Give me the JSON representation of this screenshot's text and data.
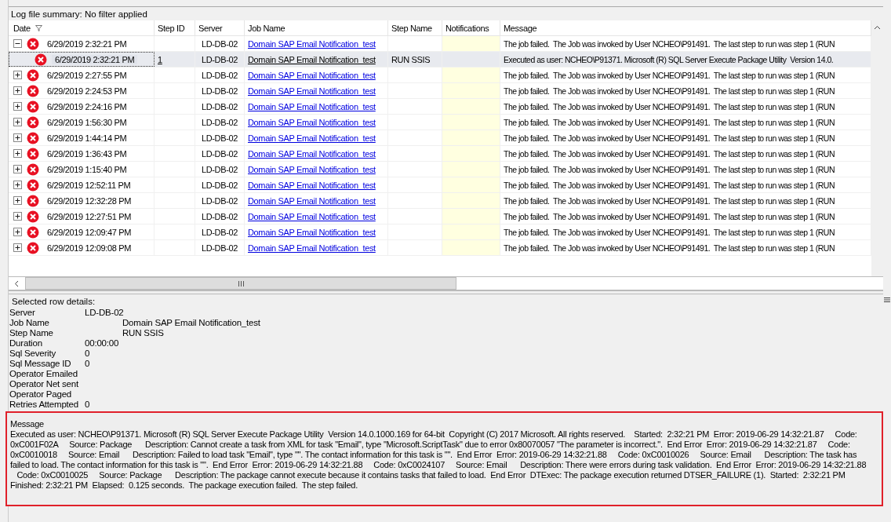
{
  "summary": "Log file summary: No filter applied",
  "columns": [
    {
      "label": "Date",
      "filter": true
    },
    {
      "label": "Step ID"
    },
    {
      "label": "Server"
    },
    {
      "label": "Job Name"
    },
    {
      "label": "Step Name"
    },
    {
      "label": "Notifications"
    },
    {
      "label": "Message"
    }
  ],
  "rows": [
    {
      "date": "6/29/2019 2:32:21 PM",
      "server": "LD-DB-02",
      "job": "Domain SAP Email Notification_test",
      "message": "The job failed.  The Job was invoked by User NCHEO\\P91491.  The last step to run was step 1 (RUN",
      "expanded": true,
      "selected": false,
      "children": [
        {
          "date": "6/29/2019 2:32:21 PM",
          "step_id": "1",
          "server": "LD-DB-02",
          "job": "Domain SAP Email Notification_test",
          "step_name": "RUN SSIS",
          "message": "Executed as user: NCHEO\\P91371. Microsoft (R) SQL Server Execute Package Utility  Version 14.0.",
          "selected": true
        }
      ]
    },
    {
      "date": "6/29/2019 2:27:55 PM",
      "server": "LD-DB-02",
      "job": "Domain SAP Email Notification_test",
      "message": "The job failed.  The Job was invoked by User NCHEO\\P91491.  The last step to run was step 1 (RUN",
      "expanded": false,
      "selected": false
    },
    {
      "date": "6/29/2019 2:24:53 PM",
      "server": "LD-DB-02",
      "job": "Domain SAP Email Notification_test",
      "message": "The job failed.  The Job was invoked by User NCHEO\\P91491.  The last step to run was step 1 (RUN",
      "expanded": false,
      "selected": false
    },
    {
      "date": "6/29/2019 2:24:16 PM",
      "server": "LD-DB-02",
      "job": "Domain SAP Email Notification_test",
      "message": "The job failed.  The Job was invoked by User NCHEO\\P91491.  The last step to run was step 1 (RUN",
      "expanded": false,
      "selected": false
    },
    {
      "date": "6/29/2019 1:56:30 PM",
      "server": "LD-DB-02",
      "job": "Domain SAP Email Notification_test",
      "message": "The job failed.  The Job was invoked by User NCHEO\\P91491.  The last step to run was step 1 (RUN",
      "expanded": false,
      "selected": false
    },
    {
      "date": "6/29/2019 1:44:14 PM",
      "server": "LD-DB-02",
      "job": "Domain SAP Email Notification_test",
      "message": "The job failed.  The Job was invoked by User NCHEO\\P91491.  The last step to run was step 1 (RUN",
      "expanded": false,
      "selected": false
    },
    {
      "date": "6/29/2019 1:36:43 PM",
      "server": "LD-DB-02",
      "job": "Domain SAP Email Notification_test",
      "message": "The job failed.  The Job was invoked by User NCHEO\\P91491.  The last step to run was step 1 (RUN",
      "expanded": false,
      "selected": false
    },
    {
      "date": "6/29/2019 1:15:40 PM",
      "server": "LD-DB-02",
      "job": "Domain SAP Email Notification_test",
      "message": "The job failed.  The Job was invoked by User NCHEO\\P91491.  The last step to run was step 1 (RUN",
      "expanded": false,
      "selected": false
    },
    {
      "date": "6/29/2019 12:52:11 PM",
      "server": "LD-DB-02",
      "job": "Domain SAP Email Notification_test",
      "message": "The job failed.  The Job was invoked by User NCHEO\\P91491.  The last step to run was step 1 (RUN",
      "expanded": false,
      "selected": false
    },
    {
      "date": "6/29/2019 12:32:28 PM",
      "server": "LD-DB-02",
      "job": "Domain SAP Email Notification_test",
      "message": "The job failed.  The Job was invoked by User NCHEO\\P91491.  The last step to run was step 1 (RUN",
      "expanded": false,
      "selected": false
    },
    {
      "date": "6/29/2019 12:27:51 PM",
      "server": "LD-DB-02",
      "job": "Domain SAP Email Notification_test",
      "message": "The job failed.  The Job was invoked by User NCHEO\\P91491.  The last step to run was step 1 (RUN",
      "expanded": false,
      "selected": false
    },
    {
      "date": "6/29/2019 12:09:47 PM",
      "server": "LD-DB-02",
      "job": "Domain SAP Email Notification_test",
      "message": "The job failed.  The Job was invoked by User NCHEO\\P91491.  The last step to run was step 1 (RUN",
      "expanded": false,
      "selected": false
    },
    {
      "date": "6/29/2019 12:09:08 PM",
      "server": "LD-DB-02",
      "job": "Domain SAP Email Notification_test",
      "message": "The job failed.  The Job was invoked by User NCHEO\\P91491.  The last step to run was step 1 (RUN",
      "expanded": false,
      "selected": false
    }
  ],
  "details": {
    "title": "Selected row details:",
    "fields": [
      {
        "label": "Server",
        "value": "LD-DB-02",
        "kind": "near"
      },
      {
        "label": "Job Name",
        "value": "Domain SAP Email Notification_test",
        "kind": "far"
      },
      {
        "label": "Step Name",
        "value": "RUN SSIS",
        "kind": "far"
      },
      {
        "label": "Duration",
        "value": "00:00:00",
        "kind": "near"
      },
      {
        "label": "Sql Severity",
        "value": "0",
        "kind": "near"
      },
      {
        "label": "Sql Message ID",
        "value": "0",
        "kind": "near"
      },
      {
        "label": "Operator Emailed"
      },
      {
        "label": "Operator Net sent"
      },
      {
        "label": "Operator Paged"
      },
      {
        "label": "Retries Attempted",
        "value": "0",
        "kind": "near"
      }
    ]
  },
  "message": {
    "title": "Message",
    "lines": [
      "Executed as user: NCHEO\\P91371. Microsoft (R) SQL Server Execute Package Utility  Version 14.0.1000.169 for 64-bit  Copyright (C) 2017 Microsoft. All rights reserved.    Started:  2:32:21 PM  Error: 2019-06-29 14:32:21.87     Code:",
      "0xC001F02A     Source: Package      Description: Cannot create a task from XML for task \"Email\", type \"Microsoft.ScriptTask\" due to error 0x80070057 \"The parameter is incorrect.\".  End Error  Error: 2019-06-29 14:32:21.87     Code:",
      "0xC0010018     Source: Email      Description: Failed to load task \"Email\", type \"\". The contact information for this task is \"\".  End Error  Error: 2019-06-29 14:32:21.88     Code: 0xC0010026     Source: Email      Description: The task has",
      "failed to load. The contact information for this task is \"\".  End Error  Error: 2019-06-29 14:32:21.88     Code: 0xC0024107     Source: Email      Description: There were errors during task validation.  End Error  Error: 2019-06-29 14:32:21.88",
      "   Code: 0xC0010025     Source: Package      Description: The package cannot execute because it contains tasks that failed to load.  End Error  DTExec: The package execution returned DTSER_FAILURE (1).  Started:  2:32:21 PM",
      "Finished: 2:32:21 PM  Elapsed:  0.125 seconds.  The package execution failed.  The step failed."
    ]
  }
}
